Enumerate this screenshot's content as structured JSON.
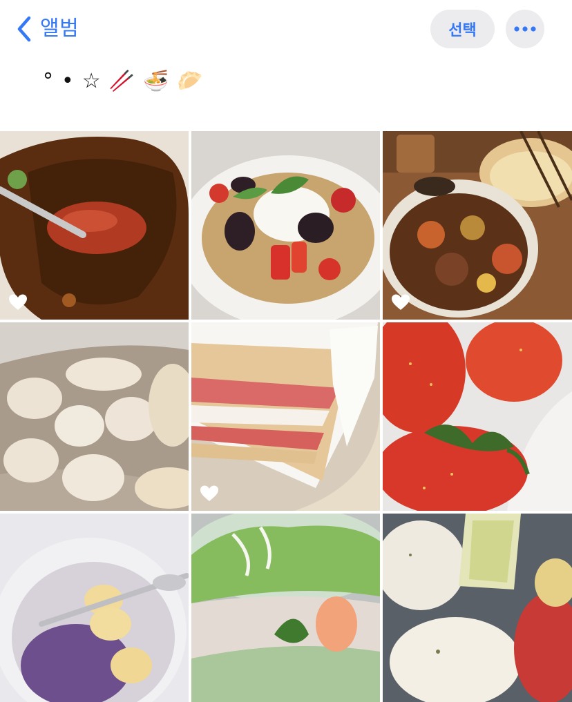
{
  "nav": {
    "back_label": "앨범",
    "back_icon": "chevron-left-icon",
    "select_label": "선택",
    "more_icon": "ellipsis-icon"
  },
  "album": {
    "title_glyphs": [
      "°",
      "•",
      "☆",
      "🥢",
      "🍜",
      "🥟"
    ]
  },
  "colors": {
    "accent": "#3478f6",
    "pill_bg": "#ececee"
  },
  "photos": [
    {
      "subject": "tomato in brown sauce on a spoon",
      "favorite": true
    },
    {
      "subject": "burrata with strawberries, blackberries and granola",
      "favorite": false
    },
    {
      "subject": "braised stew with steamed dumplings",
      "favorite": true
    },
    {
      "subject": "handmade dumplings on parchment",
      "favorite": false
    },
    {
      "subject": "strawberry cream layer cake slice",
      "favorite": true
    },
    {
      "subject": "fresh strawberries",
      "favorite": false
    },
    {
      "subject": "bowl with banana slices and purple yogurt",
      "favorite": false
    },
    {
      "subject": "fresh spring rolls",
      "favorite": false
    },
    {
      "subject": "baked potatoes and roasted vegetables",
      "favorite": false
    }
  ]
}
